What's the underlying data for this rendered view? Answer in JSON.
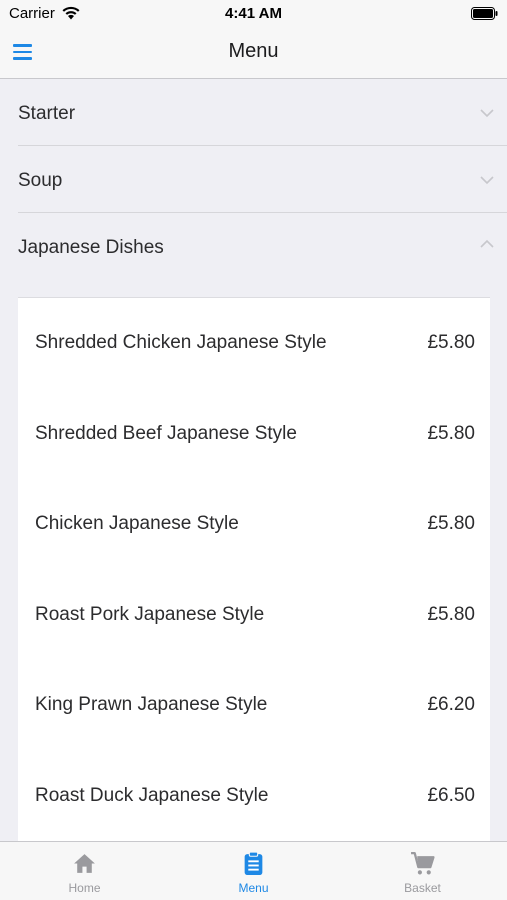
{
  "status_bar": {
    "carrier": "Carrier",
    "time": "4:41 AM"
  },
  "nav": {
    "title": "Menu"
  },
  "categories": [
    {
      "label": "Starter",
      "expanded": false
    },
    {
      "label": "Soup",
      "expanded": false
    },
    {
      "label": "Japanese Dishes",
      "expanded": true
    }
  ],
  "dishes": [
    {
      "name": "Shredded Chicken Japanese Style",
      "price": "£5.80"
    },
    {
      "name": "Shredded Beef Japanese Style",
      "price": "£5.80"
    },
    {
      "name": "Chicken Japanese Style",
      "price": "£5.80"
    },
    {
      "name": "Roast Pork Japanese Style",
      "price": "£5.80"
    },
    {
      "name": "King Prawn Japanese Style",
      "price": "£6.20"
    },
    {
      "name": "Roast Duck Japanese Style",
      "price": "£6.50"
    }
  ],
  "tabs": [
    {
      "label": "Home",
      "icon": "home-icon",
      "active": false
    },
    {
      "label": "Menu",
      "icon": "clipboard-icon",
      "active": true
    },
    {
      "label": "Basket",
      "icon": "cart-icon",
      "active": false
    }
  ],
  "colors": {
    "accent": "#1e88e5",
    "inactive_tab": "#9a9a9e",
    "background": "#efeff4"
  }
}
